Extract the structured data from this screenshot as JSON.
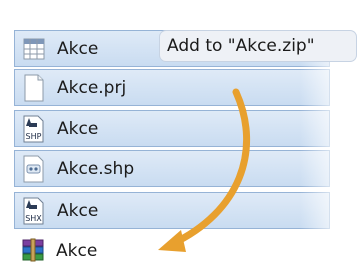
{
  "files": [
    {
      "label": "Akce",
      "icon": "table-file-icon"
    },
    {
      "label": "Akce.prj",
      "icon": "blank-document-icon"
    },
    {
      "label": "Akce",
      "icon": "shp-file-icon"
    },
    {
      "label": "Akce.shp",
      "icon": "settings-document-icon"
    },
    {
      "label": "Akce",
      "icon": "shx-file-icon"
    },
    {
      "label": "Akce",
      "icon": "winrar-archive-icon"
    }
  ],
  "tooltip": {
    "text": "Add to \"Akce.zip\""
  },
  "icons": {
    "shp_tag": "SHP",
    "shx_tag": "SHX"
  },
  "colors": {
    "selection": "#c9dcf1",
    "arrow": "#e8a02e"
  }
}
